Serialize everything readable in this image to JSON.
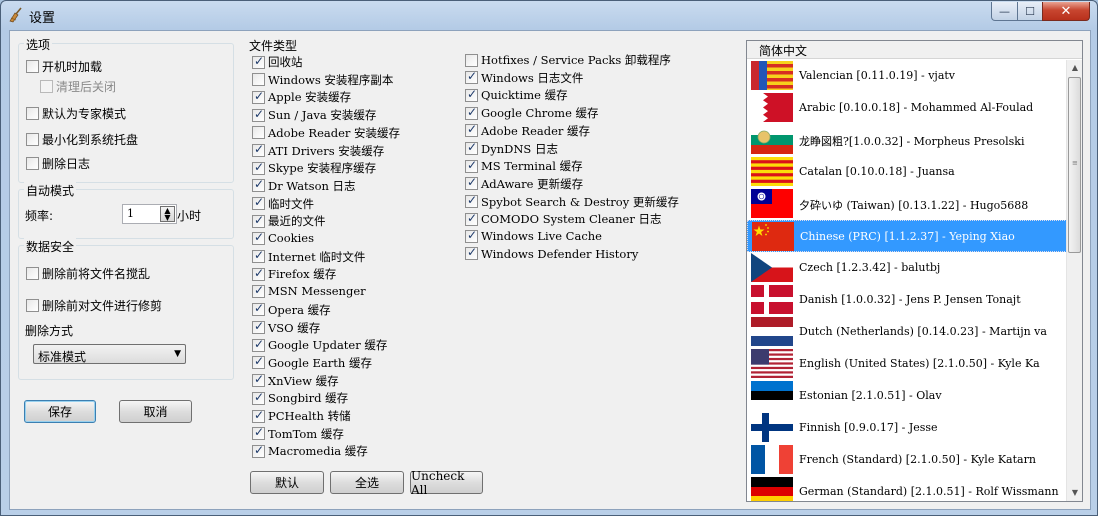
{
  "window": {
    "title": "设置",
    "min_label": "—",
    "max_label": "☐",
    "close_label": "✕"
  },
  "options": {
    "title": "选项",
    "startup": "开机时加载",
    "cleanup_close": "清理后关闭",
    "expert": "默认为专家模式",
    "tray": "最小化到系统托盘",
    "delete_log": "删除日志"
  },
  "auto": {
    "title": "自动模式",
    "freq_label": "频率:",
    "freq_value": "1",
    "unit": "小时"
  },
  "security": {
    "title": "数据安全",
    "scramble": "删除前将文件名搅乱",
    "overwrite": "删除前对文件进行修剪",
    "method_label": "删除方式",
    "method_value": "标准模式"
  },
  "buttons": {
    "save": "保存",
    "cancel": "取消",
    "default": "默认",
    "select_all": "全选",
    "uncheck_all": "Uncheck All"
  },
  "filetypes": {
    "title": "文件类型",
    "col1": [
      {
        "label": "回收站",
        "checked": true
      },
      {
        "label": "Windows 安装程序副本",
        "checked": false
      },
      {
        "label": "Apple 安装缓存",
        "checked": true
      },
      {
        "label": "Sun / Java 安装缓存",
        "checked": true
      },
      {
        "label": "Adobe Reader 安装缓存",
        "checked": false
      },
      {
        "label": "ATI Drivers 安装缓存",
        "checked": true
      },
      {
        "label": "Skype 安装程序缓存",
        "checked": true
      },
      {
        "label": "Dr Watson 日志",
        "checked": true
      },
      {
        "label": "临时文件",
        "checked": true
      },
      {
        "label": "最近的文件",
        "checked": true
      },
      {
        "label": "Cookies",
        "checked": true
      },
      {
        "label": "Internet 临时文件",
        "checked": true
      },
      {
        "label": "Firefox 缓存",
        "checked": true
      },
      {
        "label": "MSN Messenger",
        "checked": true
      },
      {
        "label": "Opera 缓存",
        "checked": true
      },
      {
        "label": "VSO 缓存",
        "checked": true
      },
      {
        "label": "Google Updater 缓存",
        "checked": true
      },
      {
        "label": "Google Earth 缓存",
        "checked": true
      },
      {
        "label": "XnView 缓存",
        "checked": true
      },
      {
        "label": "Songbird 缓存",
        "checked": true
      },
      {
        "label": "PCHealth 转储",
        "checked": true
      },
      {
        "label": "TomTom 缓存",
        "checked": true
      },
      {
        "label": "Macromedia 缓存",
        "checked": true
      }
    ],
    "col2": [
      {
        "label": "Hotfixes / Service Packs 卸载程序",
        "checked": false
      },
      {
        "label": "Windows 日志文件",
        "checked": true
      },
      {
        "label": "Quicktime 缓存",
        "checked": true
      },
      {
        "label": "Google Chrome 缓存",
        "checked": true
      },
      {
        "label": "Adobe Reader 缓存",
        "checked": true
      },
      {
        "label": "DynDNS 日志",
        "checked": true
      },
      {
        "label": "MS Terminal 缓存",
        "checked": true
      },
      {
        "label": "AdAware 更新缓存",
        "checked": true
      },
      {
        "label": "Spybot Search & Destroy 更新缓存",
        "checked": true
      },
      {
        "label": "COMODO System Cleaner 日志",
        "checked": true
      },
      {
        "label": "Windows Live Cache",
        "checked": true
      },
      {
        "label": "Windows Defender History",
        "checked": true
      }
    ]
  },
  "languages": {
    "header": "简体中文",
    "items": [
      {
        "label": "Valencian [0.11.0.19] - vjatv",
        "flag": "valencia-flag"
      },
      {
        "label": "Arabic [0.10.0.18] - Mohammed Al-Foulad",
        "flag": "bahrain-flag"
      },
      {
        "label": "龙睁図粗?[1.0.0.32] - Morpheus Presolski",
        "flag": "bulgaria-flag"
      },
      {
        "label": "Catalan [0.10.0.18] - Juansa",
        "flag": "catalonia-flag"
      },
      {
        "label": "夕砕いゆ (Taiwan) [0.13.1.22] - Hugo5688",
        "flag": "taiwan-flag"
      },
      {
        "label": "Chinese (PRC) [1.1.2.37] - Yeping Xiao",
        "flag": "china-flag",
        "selected": true
      },
      {
        "label": "Czech [1.2.3.42] - balutbj",
        "flag": "czech-flag"
      },
      {
        "label": "Danish [1.0.0.32] - Jens P. Jensen Tonajt",
        "flag": "denmark-flag"
      },
      {
        "label": "Dutch (Netherlands) [0.14.0.23] - Martijn va",
        "flag": "netherlands-flag"
      },
      {
        "label": "English (United States) [2.1.0.50] - Kyle Ka",
        "flag": "usa-flag"
      },
      {
        "label": "Estonian [2.1.0.51] - Olav",
        "flag": "estonia-flag"
      },
      {
        "label": "Finnish [0.9.0.17] - Jesse",
        "flag": "finland-flag"
      },
      {
        "label": "French (Standard) [2.1.0.50] - Kyle Katarn",
        "flag": "france-flag"
      },
      {
        "label": "German (Standard) [2.1.0.51] - Rolf Wissmann",
        "flag": "germany-flag"
      }
    ]
  },
  "colors": {
    "selection": "#3399ff",
    "window_frame": "#b9cfe8",
    "client": "#f0f0f0"
  }
}
